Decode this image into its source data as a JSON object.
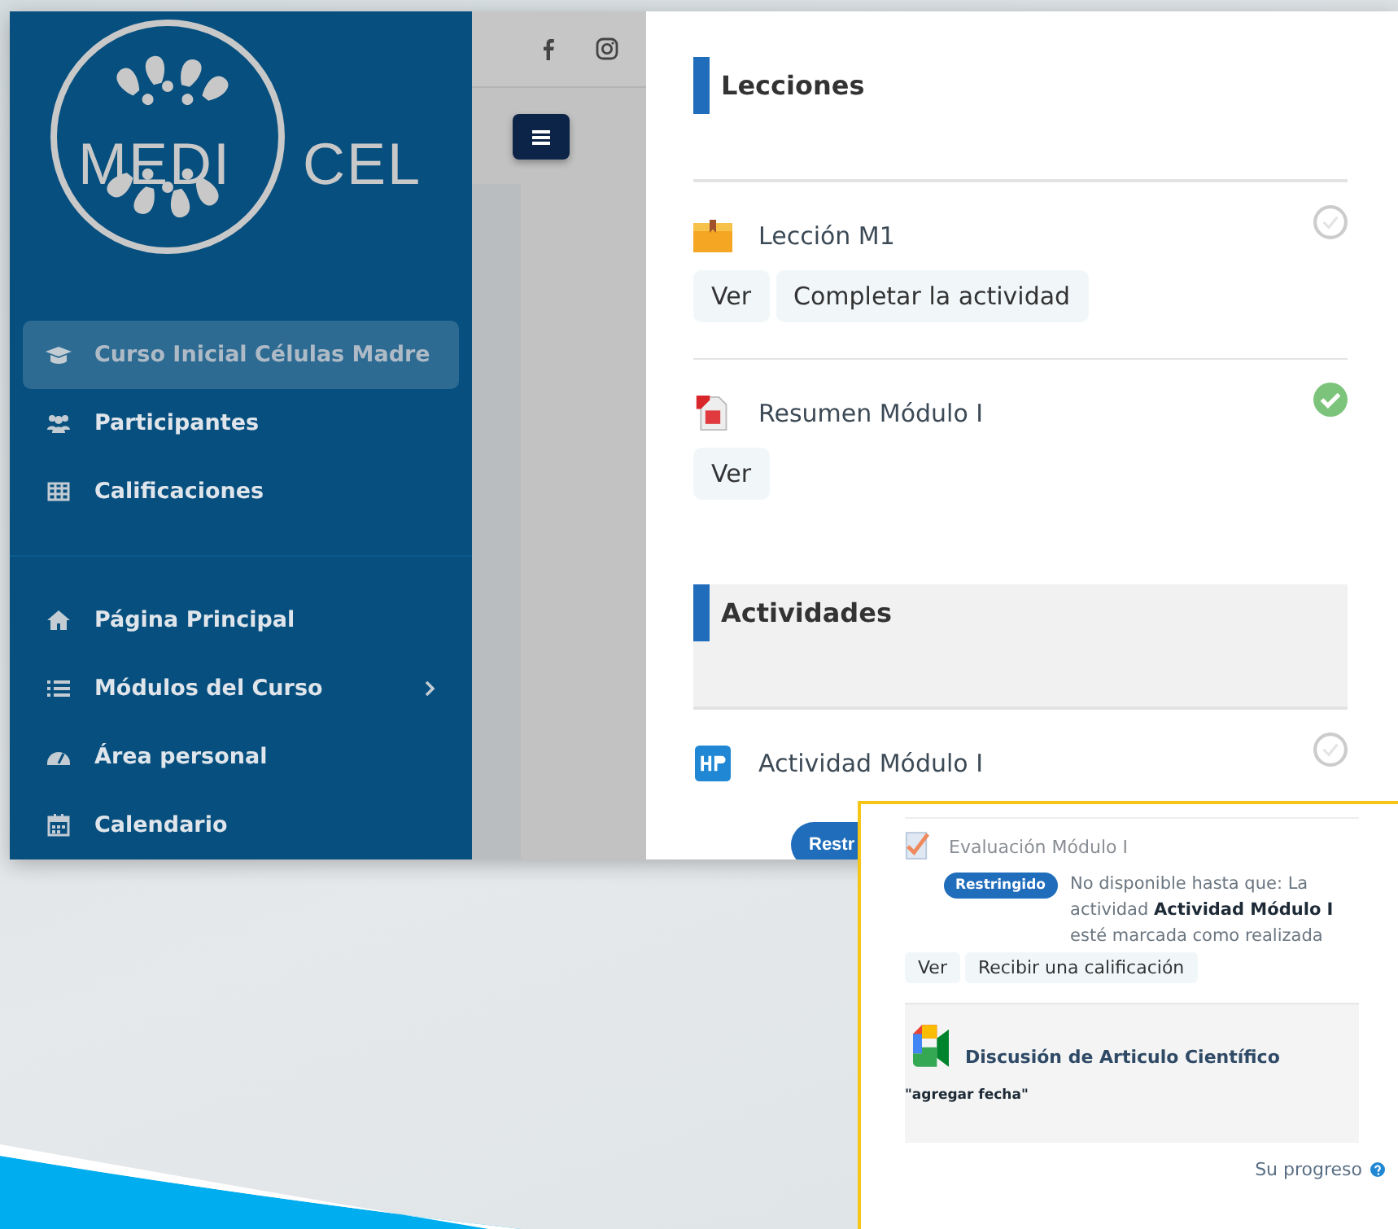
{
  "sidebar": {
    "logo": {
      "inner": "MEDI",
      "outer": "CEL"
    },
    "groups": [
      {
        "items": [
          {
            "label": "Curso Inicial Células Madre",
            "kind": "cap",
            "selected": true,
            "expandable": false
          },
          {
            "label": "Participantes",
            "kind": "users",
            "selected": false,
            "expandable": false
          },
          {
            "label": "Calificaciones",
            "kind": "table",
            "selected": false,
            "expandable": false
          }
        ]
      },
      {
        "items": [
          {
            "label": "Página Principal",
            "kind": "home",
            "selected": false,
            "expandable": false
          },
          {
            "label": "Módulos del Curso",
            "kind": "list",
            "selected": false,
            "expandable": true
          },
          {
            "label": "Área personal",
            "kind": "gauge",
            "selected": false,
            "expandable": false
          },
          {
            "label": "Calendario",
            "kind": "calendar",
            "selected": false,
            "expandable": false
          }
        ]
      }
    ]
  },
  "topbar": {
    "social": [
      {
        "kind": "facebook"
      },
      {
        "kind": "instagram"
      }
    ]
  },
  "sections": [
    {
      "title": "Lecciones",
      "shaded": false,
      "activities": [
        {
          "kind": "lesson",
          "title": "Lección M1",
          "completed": false,
          "buttons": [
            "Ver",
            "Completar la actividad"
          ]
        },
        {
          "kind": "pdf",
          "title": "Resumen Módulo I",
          "completed": true,
          "buttons": [
            "Ver"
          ]
        }
      ]
    },
    {
      "title": "Actividades",
      "shaded": true,
      "activities": [
        {
          "kind": "h5p",
          "title": "Actividad Módulo I",
          "completed": false,
          "badge": "Restr"
        }
      ]
    }
  ],
  "overlay": {
    "quiz": {
      "kind": "quiz",
      "title": "Evaluación Módulo I",
      "badge": "Restringido",
      "note": "No disponible hasta que: La actividad **Actividad Módulo I** esté marcada como realizada",
      "buttons": [
        "Ver",
        "Recibir una calificación"
      ]
    },
    "meeting": {
      "kind": "meet",
      "title": "Discusión de Articulo Científico",
      "note": "\"agregar fecha\""
    },
    "progress": "Su progreso"
  }
}
